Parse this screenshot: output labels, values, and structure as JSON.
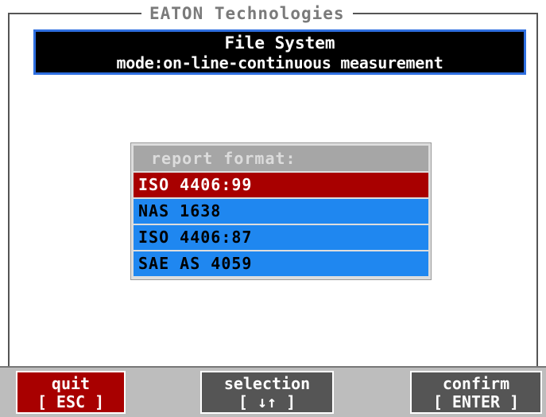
{
  "header": {
    "brand": "EATON Technologies",
    "title": "File System",
    "mode": "mode:on-line-continuous measurement"
  },
  "report_format": {
    "label": "report format:",
    "options": [
      {
        "label": "ISO 4406:99",
        "selected": true
      },
      {
        "label": "NAS 1638",
        "selected": false
      },
      {
        "label": "ISO 4406:87",
        "selected": false
      },
      {
        "label": "SAE AS 4059",
        "selected": false
      }
    ]
  },
  "function_keys": {
    "quit": {
      "label": "quit",
      "key": "[ ESC ]"
    },
    "selection": {
      "label": "selection",
      "key": "[ ↓↑ ]"
    },
    "confirm": {
      "label": "confirm",
      "key": "[ ENTER ]"
    }
  },
  "colors": {
    "selected": "#a80000",
    "option": "#1f87f0",
    "title_border": "#2f6fe0"
  }
}
